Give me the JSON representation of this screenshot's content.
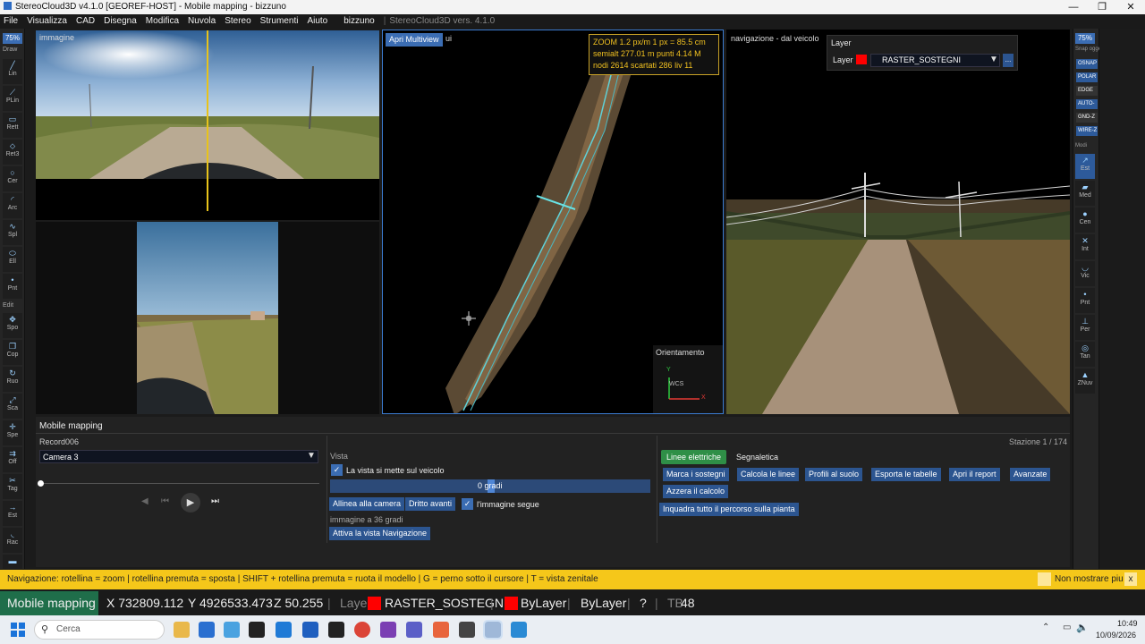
{
  "window": {
    "title": "StereoCloud3D v4.1.0  [GEOREF-HOST] - Mobile mapping - bizzuno"
  },
  "menu": {
    "items": [
      "File",
      "Visualizza",
      "CAD",
      "Disegna",
      "Modifica",
      "Nuvola",
      "Stereo",
      "Strumenti",
      "Aiuto"
    ],
    "project": "bizzuno",
    "version": "StereoCloud3D vers. 4.1.0"
  },
  "left_toolbar": {
    "zoom": "75%",
    "draw_label": "Draw",
    "edit_label": "Edit",
    "draw_tools": [
      {
        "icon": "line-icon",
        "glyph": "╱",
        "label": "Lin"
      },
      {
        "icon": "polyline-icon",
        "glyph": "⟋",
        "label": "PLin"
      },
      {
        "icon": "rectangle-icon",
        "glyph": "▭",
        "label": "Rett"
      },
      {
        "icon": "rect3-icon",
        "glyph": "⬦",
        "label": "Ret3"
      },
      {
        "icon": "circle-icon",
        "glyph": "○",
        "label": "Cer"
      },
      {
        "icon": "arc-icon",
        "glyph": "◜",
        "label": "Arc"
      },
      {
        "icon": "spline-icon",
        "glyph": "∿",
        "label": "Spl"
      },
      {
        "icon": "ellipse-icon",
        "glyph": "⬭",
        "label": "Ell"
      },
      {
        "icon": "point-icon",
        "glyph": "•",
        "label": "Pnt"
      }
    ],
    "edit_tools": [
      {
        "icon": "move-icon",
        "glyph": "✥",
        "label": "Spo"
      },
      {
        "icon": "copy-icon",
        "glyph": "❐",
        "label": "Cop"
      },
      {
        "icon": "rotate-icon",
        "glyph": "↻",
        "label": "Ruo"
      },
      {
        "icon": "scale-icon",
        "glyph": "⤢",
        "label": "Sca"
      },
      {
        "icon": "stretch-icon",
        "glyph": "✛",
        "label": "Spe"
      },
      {
        "icon": "offset-icon",
        "glyph": "⇉",
        "label": "Off"
      },
      {
        "icon": "trim-icon",
        "glyph": "✂",
        "label": "Tag"
      },
      {
        "icon": "extend-icon",
        "glyph": "→",
        "label": "Est"
      },
      {
        "icon": "fillet-icon",
        "glyph": "◟",
        "label": "Rac"
      },
      {
        "icon": "lock-icon",
        "glyph": "▬",
        "label": ""
      }
    ]
  },
  "right_toolbar": {
    "zoom": "75%",
    "snap_label": "Snap oggetto",
    "snaps": [
      {
        "label": "OSNAP",
        "on": true
      },
      {
        "label": "POLAR",
        "on": true
      },
      {
        "label": "EDGE",
        "on": false
      },
      {
        "label": "AUTO-",
        "on": true
      },
      {
        "label": "GND-Z",
        "on": false
      },
      {
        "label": "WIRE-Z",
        "on": true
      }
    ],
    "modes_label": "Modi",
    "modes": [
      {
        "icon": "extend-mode-icon",
        "glyph": "↗",
        "label": "Est",
        "active": true
      },
      {
        "icon": "midpoint-icon",
        "glyph": "▰",
        "label": "Med",
        "active": false
      },
      {
        "icon": "center-icon",
        "glyph": "●",
        "label": "Cen",
        "active": false
      },
      {
        "icon": "intersection-icon",
        "glyph": "✕",
        "label": "Int",
        "active": false
      },
      {
        "icon": "nearest-icon",
        "glyph": "◡",
        "label": "Vic",
        "active": false
      },
      {
        "icon": "node-icon",
        "glyph": "•",
        "label": "Pnt",
        "active": false
      },
      {
        "icon": "perpendicular-icon",
        "glyph": "⊥",
        "label": "Per",
        "active": false
      },
      {
        "icon": "tangent-icon",
        "glyph": "◎",
        "label": "Tan",
        "active": false
      },
      {
        "icon": "znuv-icon",
        "glyph": "▲",
        "label": "ZNuv",
        "active": false
      }
    ]
  },
  "panes": {
    "image_title": "immagine",
    "map_button": "Apri Multiview",
    "map_title_suffix": "ui",
    "map_info": {
      "zoom": "ZOOM  1.2 px/m   1 px = 85.5 cm",
      "line2": "semialt 277.01 m      punti 4.14 M",
      "line3": "nodi 2614  scartati 286  liv 11"
    },
    "orientation_title": "Orientamento",
    "axis_y": "Y",
    "axis_x": "X",
    "axis_ucs": "WCS",
    "nav_title": "navigazione - dal veicolo",
    "layer_panel": {
      "title": "Layer",
      "label": "Layer",
      "value": "RASTER_SOSTEGNI",
      "color": "#ff0000",
      "more": "..."
    }
  },
  "mobile_mapping": {
    "title": "Mobile mapping",
    "record": "Record006",
    "station": "Stazione 1 / 174",
    "camera": "Camera 3",
    "progress": 0,
    "vista_label": "Vista",
    "follow_vehicle": "La vista si mette sul veicolo",
    "angle_text": "0 gradi",
    "align_camera": "Allinea alla camera",
    "straight_ahead": "Dritto avanti",
    "image_follows": "l'immagine segue",
    "image_angle": "immagine a 36 gradi",
    "activate_nav": "Attiva la vista Navigazione",
    "tabs": [
      "Linee elettriche",
      "Segnaletica"
    ],
    "actions": [
      "Marca i sostegni",
      "Calcola le linee",
      "Profili al suolo",
      "Esporta le tabelle",
      "Apri il report",
      "Avanzate"
    ],
    "reset": "Azzera il calcolo",
    "frame_path": "Inquadra tutto il percorso sulla pianta"
  },
  "hint": {
    "text": "Navigazione: rotellina = zoom   |  rotellina premuta = sposta   |  SHIFT + rotellina premuta = ruota il modello   |  G = perno sotto il cursore   |  T = vista zenitale",
    "dont_show": "Non mostrare piu",
    "close": "x"
  },
  "status": {
    "mode": "Mobile mapping",
    "x": "X 732809.112",
    "y": "Y 4926533.473",
    "z": "Z 50.255",
    "layer_label": "Layer",
    "layer": "RASTER_SOSTEGNI",
    "color_label": "ByLayer",
    "linetype": "ByLayer",
    "help": "?",
    "tb_prefix": "TB",
    "tb_value": "48"
  },
  "taskbar": {
    "search": "Cerca",
    "time": "10:49",
    "date": "10/09/2026"
  },
  "colors": {
    "accent": "#3b6db3",
    "hint_bg": "#f5c71a",
    "status_green": "#1f6e4a",
    "tab_green": "#2f8f47"
  }
}
